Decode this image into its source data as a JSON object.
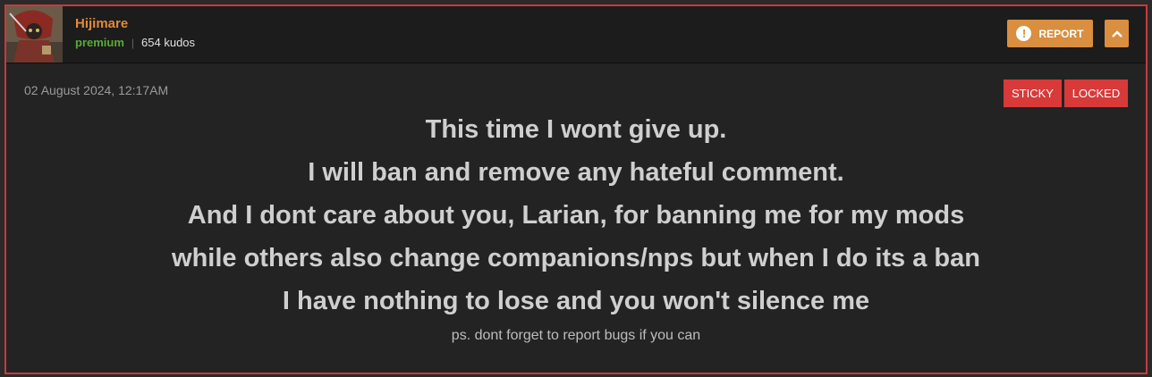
{
  "post": {
    "author": {
      "name": "Hijimare",
      "rank": "premium",
      "kudos": "654 kudos"
    },
    "actions": {
      "report_label": "REPORT",
      "report_icon": "exclamation-icon",
      "collapse_icon": "chevron-up-icon"
    },
    "date": "02 August 2024, 12:17AM",
    "tags": [
      "STICKY",
      "LOCKED"
    ],
    "lines": [
      "This time I wont give up.",
      "I will ban and remove any hateful comment.",
      "And I dont care about you, Larian, for banning me for my mods",
      "while others also change companions/nps but when I do its a ban",
      "I have nothing to lose and you won't silence me"
    ],
    "ps": "ps. dont forget to report bugs if you can"
  },
  "colors": {
    "border": "#c73b3b",
    "accent": "#d98e40",
    "username": "#e08a3a",
    "premium": "#5aaa3a",
    "tag": "#d83a3a"
  }
}
